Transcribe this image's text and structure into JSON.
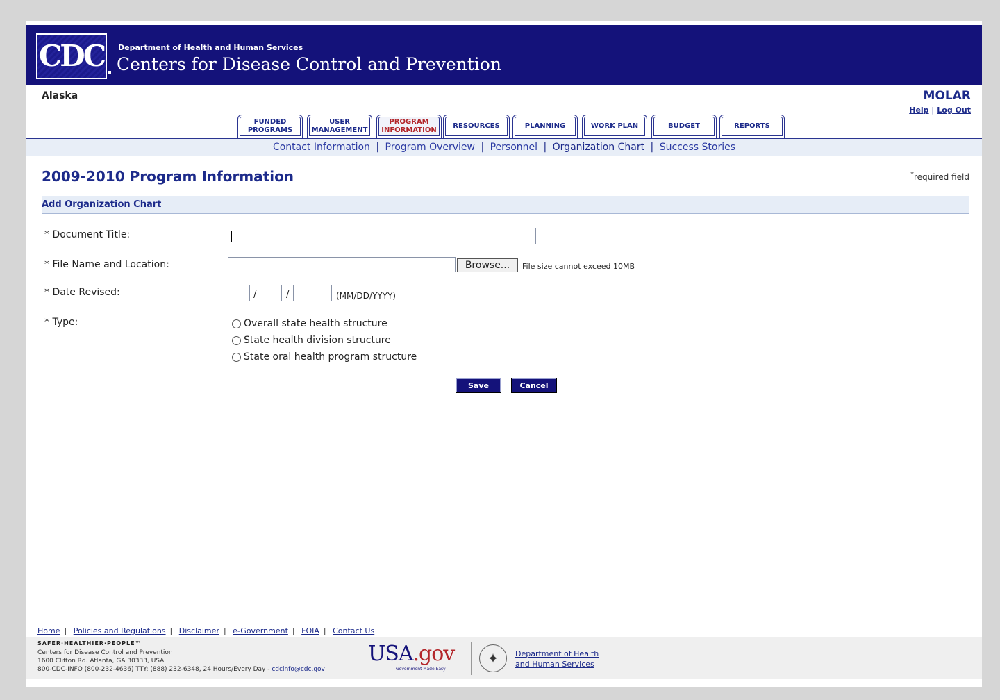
{
  "header": {
    "logo_text": "CDC",
    "dept": "Department of Health and Human Services",
    "agency": "Centers for Disease Control and Prevention",
    "state": "Alaska",
    "app_name": "MOLAR",
    "help": "Help",
    "logout": "Log Out",
    "util_sep": "|"
  },
  "tabs": [
    {
      "line1": "FUNDED",
      "line2": "PROGRAMS"
    },
    {
      "line1": "USER",
      "line2": "MANAGEMENT"
    },
    {
      "line1": "PROGRAM",
      "line2": "INFORMATION"
    },
    {
      "line1": "RESOURCES",
      "line2": ""
    },
    {
      "line1": "PLANNING",
      "line2": ""
    },
    {
      "line1": "WORK PLAN",
      "line2": ""
    },
    {
      "line1": "BUDGET",
      "line2": ""
    },
    {
      "line1": "REPORTS",
      "line2": ""
    }
  ],
  "active_tab": "PROGRAM INFORMATION",
  "subnav": {
    "contact": "Contact Information",
    "overview": "Program Overview",
    "personnel": "Personnel",
    "org_chart": "Organization Chart",
    "success": "Success Stories",
    "sep": "|"
  },
  "page": {
    "title": "2009-2010 Program Information",
    "required_mark": "*",
    "required_text": "required field",
    "section": "Add Organization Chart"
  },
  "form": {
    "doc_title_label": "* Document Title:",
    "doc_title_value": "",
    "file_label": "* File Name and Location:",
    "browse": "Browse...",
    "file_note": "File size cannot exceed 10MB",
    "date_label": "* Date Revised:",
    "date_sep": "/",
    "date_format": "(MM/DD/YYYY)",
    "type_label": "* Type:",
    "types": [
      "Overall state health structure",
      "State health division structure",
      "State oral health program structure"
    ],
    "save": "Save",
    "cancel": "Cancel"
  },
  "footer": {
    "links": [
      "Home",
      "Policies and Regulations",
      "Disclaimer",
      "e-Government",
      "FOIA",
      "Contact Us"
    ],
    "sep": "|",
    "tagline": "SAFER·HEALTHIER·PEOPLE™",
    "addr1": "Centers for Disease Control and Prevention",
    "addr2": "1600 Clifton Rd. Atlanta, GA 30333, USA",
    "addr3": "800-CDC-INFO (800-232-4636) TTY: (888) 232-6348, 24 Hours/Every Day - ",
    "email": "cdcinfo@cdc.gov",
    "usa_a": "USA",
    "usa_b": ".gov",
    "usa_tag": "Government Made Easy",
    "hhs1": "Department of Health",
    "hhs2": "and Human Services"
  }
}
